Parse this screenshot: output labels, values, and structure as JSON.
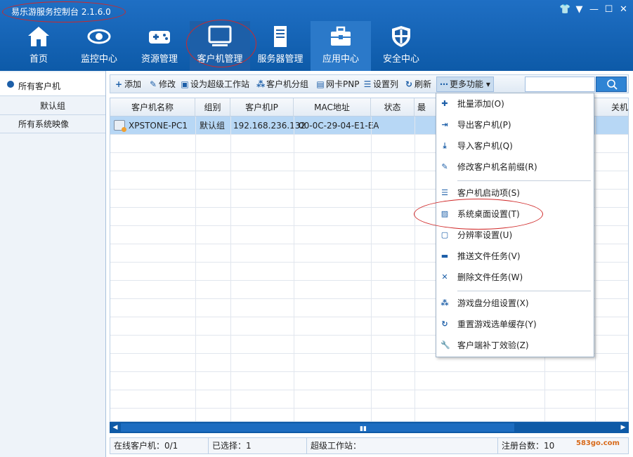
{
  "app": {
    "title": "易乐游服务控制台 2.1.6.0"
  },
  "window_buttons": [
    "👕",
    "▼",
    "—",
    "☐",
    "✕"
  ],
  "nav": [
    {
      "label": "首页",
      "icon": "home-icon"
    },
    {
      "label": "监控中心",
      "icon": "eye-icon"
    },
    {
      "label": "资源管理",
      "icon": "gamepad-icon"
    },
    {
      "label": "客户机管理",
      "icon": "monitor-icon"
    },
    {
      "label": "服务器管理",
      "icon": "server-icon"
    },
    {
      "label": "应用中心",
      "icon": "toolbox-icon"
    },
    {
      "label": "安全中心",
      "icon": "shield-icon"
    }
  ],
  "sidebar": {
    "header": "所有客户机",
    "items": [
      "默认组",
      "所有系统映像"
    ]
  },
  "toolbar": {
    "buttons": [
      {
        "label": "添加",
        "icon": "plus-icon"
      },
      {
        "label": "修改",
        "icon": "pen-icon"
      },
      {
        "label": "设为超级工作站",
        "icon": "workstation-icon"
      },
      {
        "label": "客户机分组",
        "icon": "group-icon"
      },
      {
        "label": "网卡PNP",
        "icon": "nic-icon"
      },
      {
        "label": "设置列",
        "icon": "columns-icon"
      },
      {
        "label": "刷新",
        "icon": "refresh-icon"
      }
    ],
    "more": "更多功能"
  },
  "table": {
    "columns": [
      "客户机名称",
      "组别",
      "客户机IP",
      "MAC地址",
      "状态",
      "最",
      "关机"
    ],
    "rows": [
      {
        "name": "XPSTONE-PC1",
        "group": "默认组",
        "ip": "192.168.236.132",
        "mac": "00-0C-29-04-E1-EA",
        "status": ""
      }
    ]
  },
  "menu": {
    "items": [
      {
        "label": "批量添加(O)",
        "icon": "batch-add-icon"
      },
      {
        "label": "导出客户机(P)",
        "icon": "export-icon"
      },
      {
        "label": "导入客户机(Q)",
        "icon": "import-icon"
      },
      {
        "label": "修改客户机名前缀(R)",
        "icon": "pen-icon"
      },
      {
        "label": "客户机启动项(S)",
        "icon": "list-icon"
      },
      {
        "label": "系统桌面设置(T)",
        "icon": "desktop-image-icon"
      },
      {
        "label": "分辨率设置(U)",
        "icon": "resolution-icon"
      },
      {
        "label": "推送文件任务(V)",
        "icon": "folder-icon"
      },
      {
        "label": "删除文件任务(W)",
        "icon": "delete-icon"
      },
      {
        "label": "游戏盘分组设置(X)",
        "icon": "group-icon"
      },
      {
        "label": "重置游戏选单缓存(Y)",
        "icon": "refresh-icon"
      },
      {
        "label": "客户端补丁效验(Z)",
        "icon": "wrench-icon"
      }
    ]
  },
  "status": {
    "online": "在线客户机：0/1",
    "selected": "已选择：1",
    "super": "超级工作站：",
    "registered": "注册台数：10"
  },
  "watermark": "583go.com"
}
